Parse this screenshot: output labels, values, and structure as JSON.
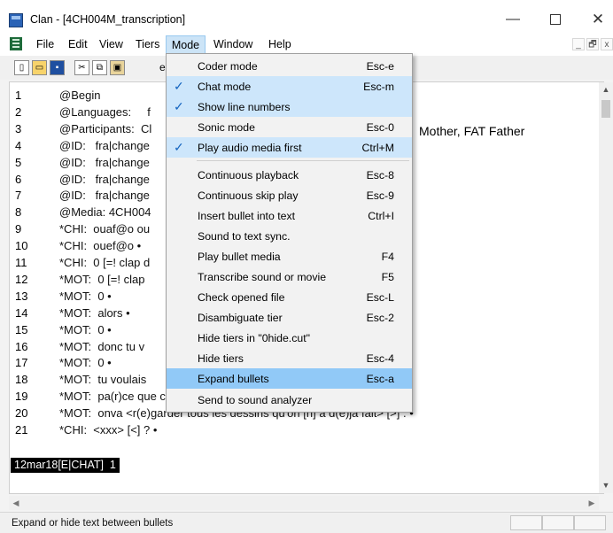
{
  "window": {
    "title": "Clan - [4CH004M_transcription]",
    "controls": {
      "minimize": "—",
      "close": "✕"
    }
  },
  "menubar": {
    "items": [
      "File",
      "Edit",
      "View",
      "Tiers",
      "Mode",
      "Window",
      "Help"
    ],
    "active": "Mode",
    "mdi_controls": [
      "_",
      "🗗",
      "x"
    ]
  },
  "toolbar": {
    "icons": [
      "new-file-icon",
      "open-file-icon",
      "save-icon",
      "cut-icon",
      "copy-icon",
      "paste-icon"
    ],
    "hint": "e"
  },
  "document": {
    "lines": [
      {
        "n": "1",
        "text": "@Begin"
      },
      {
        "n": "2",
        "text": "@Languages:     f"
      },
      {
        "n": "3",
        "text": "@Participants:  Cl"
      },
      {
        "n": "4",
        "text": "@ID:   fra|change"
      },
      {
        "n": "5",
        "text": "@ID:   fra|change"
      },
      {
        "n": "6",
        "text": "@ID:   fra|change"
      },
      {
        "n": "7",
        "text": "@ID:   fra|change"
      },
      {
        "n": "8",
        "text": "@Media: 4CH004"
      },
      {
        "n": "9",
        "text": "*CHI:  ouaf@o ou"
      },
      {
        "n": "10",
        "text": "*CHI:  ouef@o •"
      },
      {
        "n": "11",
        "text": "*CHI:  0 [=! clap d"
      },
      {
        "n": "12",
        "text": "*MOT:  0 [=! clap"
      },
      {
        "n": "13",
        "text": "*MOT:  0 •"
      },
      {
        "n": "14",
        "text": "*MOT:  alors •"
      },
      {
        "n": "15",
        "text": "*MOT:  0 •"
      },
      {
        "n": "16",
        "text": "*MOT:  donc tu v"
      },
      {
        "n": "17",
        "text": "*MOT:  0 •"
      },
      {
        "n": "18",
        "text": "*MOT:  tu voulais"
      },
      {
        "n": "19",
        "text": "*MOT:  pa(r)ce que c'est vrai qu'on a fait déjà le dessin . •"
      },
      {
        "n": "20",
        "text": "*MOT:  onva <r(e)garder tous les dessins qu'on [n] a d(é)jà fait> [>] . •"
      },
      {
        "n": "21",
        "text": "*CHI:  <xxx> [<] ? •"
      }
    ],
    "participants_tail": "Mother, FAT Father",
    "status_tag": "12mar18[E|CHAT]  1"
  },
  "mode_menu": {
    "items": [
      {
        "label": "Coder mode",
        "shortcut": "Esc-e",
        "checked": false
      },
      {
        "label": "Chat mode",
        "shortcut": "Esc-m",
        "checked": true
      },
      {
        "label": "Show line numbers",
        "shortcut": "",
        "checked": true
      },
      {
        "label": "Sonic mode",
        "shortcut": "Esc-0",
        "checked": false
      },
      {
        "label": "Play audio media first",
        "shortcut": "Ctrl+M",
        "checked": true
      },
      {
        "label": "Continuous playback",
        "shortcut": "Esc-8",
        "checked": false
      },
      {
        "label": "Continuous skip play",
        "shortcut": "Esc-9",
        "checked": false
      },
      {
        "label": "Insert bullet into text",
        "shortcut": "Ctrl+I",
        "checked": false
      },
      {
        "label": "Sound to text sync.",
        "shortcut": "",
        "checked": false
      },
      {
        "label": "Play bullet media",
        "shortcut": "F4",
        "checked": false
      },
      {
        "label": "Transcribe sound or movie",
        "shortcut": "F5",
        "checked": false
      },
      {
        "label": "Check opened file",
        "shortcut": "Esc-L",
        "checked": false
      },
      {
        "label": "Disambiguate tier",
        "shortcut": "Esc-2",
        "checked": false
      },
      {
        "label": "Hide tiers in \"0hide.cut\"",
        "shortcut": "",
        "checked": false
      },
      {
        "label": "Hide tiers",
        "shortcut": "Esc-4",
        "checked": false
      },
      {
        "label": "Expand bullets",
        "shortcut": "Esc-a",
        "checked": false,
        "highlighted": true
      },
      {
        "label": "Send to sound analyzer",
        "shortcut": "",
        "checked": false
      }
    ],
    "check_glyph": "✓"
  },
  "statusbar": {
    "text": "Expand or hide text between bullets"
  },
  "colors": {
    "highlight": "#91c9f7",
    "checked_bg": "#cde6fb",
    "check": "#1565c0"
  }
}
